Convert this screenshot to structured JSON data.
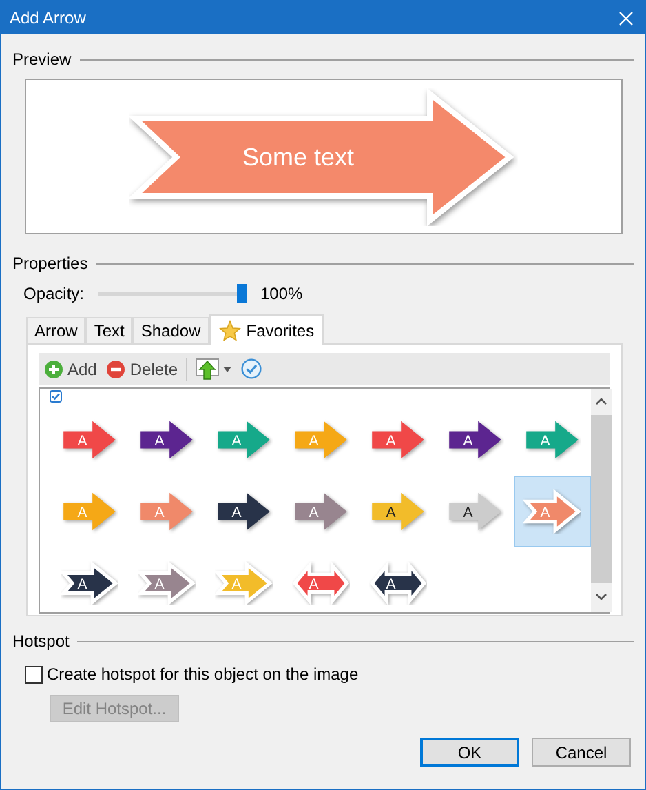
{
  "window": {
    "title": "Add Arrow"
  },
  "preview": {
    "label": "Preview",
    "arrow_text": "Some text"
  },
  "properties": {
    "label": "Properties",
    "opacity": {
      "label": "Opacity:",
      "level": 1,
      "reading": "100%"
    }
  },
  "tabs": [
    {
      "label": "Arrow",
      "selected": false
    },
    {
      "label": "Text",
      "selected": false
    },
    {
      "label": "Shadow",
      "selected": false
    },
    {
      "label": "Favorites",
      "selected": true
    }
  ],
  "toolbar": {
    "add": "Add",
    "delete": "Delete"
  },
  "gallery": {
    "items": [
      {
        "label": "A",
        "kind": "flat",
        "color": "#f04848",
        "dark_text": false,
        "selected": false
      },
      {
        "label": "A",
        "kind": "flat",
        "color": "#5c2590",
        "dark_text": false,
        "selected": false
      },
      {
        "label": "A",
        "kind": "flat",
        "color": "#16a98a",
        "dark_text": false,
        "selected": false
      },
      {
        "label": "A",
        "kind": "flat",
        "color": "#f5a816",
        "dark_text": false,
        "selected": false
      },
      {
        "label": "A",
        "kind": "flat",
        "color": "#f04848",
        "dark_text": false,
        "selected": false
      },
      {
        "label": "A",
        "kind": "flat",
        "color": "#5c2590",
        "dark_text": false,
        "selected": false
      },
      {
        "label": "A",
        "kind": "flat",
        "color": "#16a98a",
        "dark_text": false,
        "selected": false
      },
      {
        "label": "A",
        "kind": "flat",
        "color": "#f5a816",
        "dark_text": false,
        "selected": false
      },
      {
        "label": "A",
        "kind": "flat",
        "color": "#f0896a",
        "dark_text": false,
        "selected": false
      },
      {
        "label": "A",
        "kind": "flat",
        "color": "#283349",
        "dark_text": false,
        "selected": false
      },
      {
        "label": "A",
        "kind": "flat",
        "color": "#98858f",
        "dark_text": false,
        "selected": false
      },
      {
        "label": "A",
        "kind": "flat",
        "color": "#f2bc2a",
        "dark_text": true,
        "selected": false
      },
      {
        "label": "A",
        "kind": "flat",
        "color": "#cccccc",
        "dark_text": true,
        "selected": false
      },
      {
        "label": "A",
        "kind": "outlined",
        "color": "#f0896a",
        "dark_text": false,
        "selected": true
      },
      {
        "label": "A",
        "kind": "outlined",
        "color": "#283349",
        "dark_text": false,
        "selected": false
      },
      {
        "label": "A",
        "kind": "outlined",
        "color": "#98858f",
        "dark_text": false,
        "selected": false
      },
      {
        "label": "A",
        "kind": "outlined",
        "color": "#f2bc2a",
        "dark_text": false,
        "selected": false
      },
      {
        "label": "A",
        "kind": "double",
        "color": "#f04848",
        "dark_text": false,
        "selected": false
      },
      {
        "label": "A",
        "kind": "double",
        "color": "#283349",
        "dark_text": false,
        "selected": false
      }
    ]
  },
  "hotspot": {
    "label": "Hotspot",
    "checkbox": {
      "label": "Create hotspot for this object on the image",
      "checked": false
    },
    "edit_button": {
      "label": "Edit Hotspot...",
      "disabled": true
    }
  },
  "buttons": [
    {
      "label": "OK",
      "default": true
    },
    {
      "label": "Cancel",
      "default": false
    }
  ]
}
